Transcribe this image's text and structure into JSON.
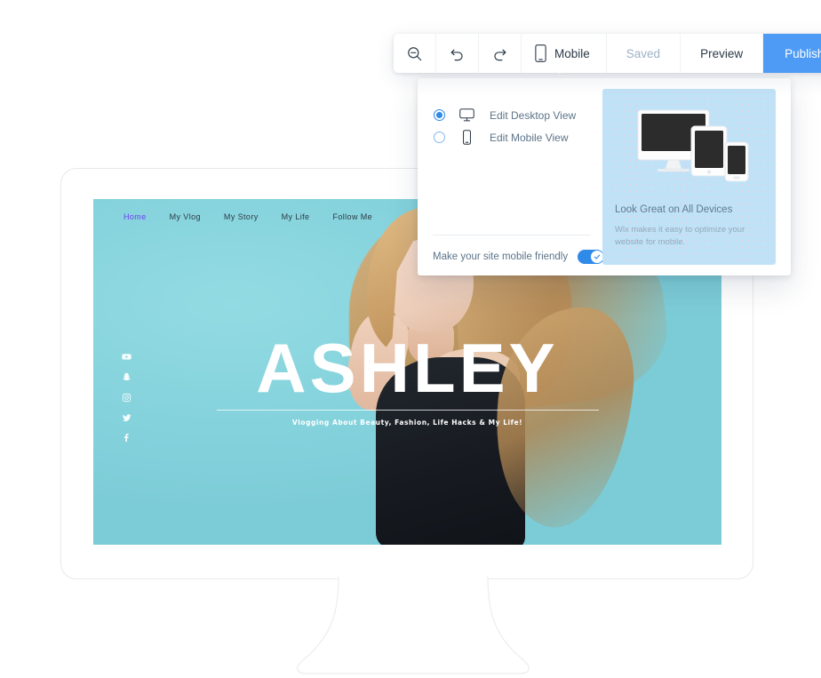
{
  "toolbar": {
    "zoom_out_icon": "zoom-out-icon",
    "undo_icon": "undo-icon",
    "redo_icon": "redo-icon",
    "mobile_icon": "mobile-phone-icon",
    "mobile_label": "Mobile",
    "saved_label": "Saved",
    "preview_label": "Preview",
    "publish_label": "Publish",
    "publish_color": "#4d9bf5",
    "saved_color": "#9db2c6"
  },
  "mobile_panel": {
    "options": [
      {
        "label": "Edit Desktop View",
        "icon": "desktop-monitor-icon",
        "selected": true
      },
      {
        "label": "Edit Mobile View",
        "icon": "mobile-phone-icon",
        "selected": false
      }
    ],
    "mobile_friendly_label": "Make your site mobile friendly",
    "mobile_friendly_on": true,
    "toggle_color": "#2f8ae8",
    "promo": {
      "heading": "Look Great on All Devices",
      "body": "Wix makes it easy to optimize your website for mobile.",
      "bg_color": "#bfe2f7"
    }
  },
  "site": {
    "nav": [
      {
        "label": "Home",
        "active": true
      },
      {
        "label": "My Vlog",
        "active": false
      },
      {
        "label": "My Story",
        "active": false
      },
      {
        "label": "My Life",
        "active": false
      },
      {
        "label": "Follow Me",
        "active": false
      }
    ],
    "active_nav_color": "#6e3ff0",
    "hero_title": "ASHLEY",
    "hero_tagline": "Vlogging About Beauty, Fashion, Life Hacks & My Life!",
    "hero_bg_color": "#84d2dc",
    "social_icons": [
      "youtube-icon",
      "snapchat-icon",
      "instagram-icon",
      "twitter-icon",
      "facebook-icon"
    ]
  }
}
